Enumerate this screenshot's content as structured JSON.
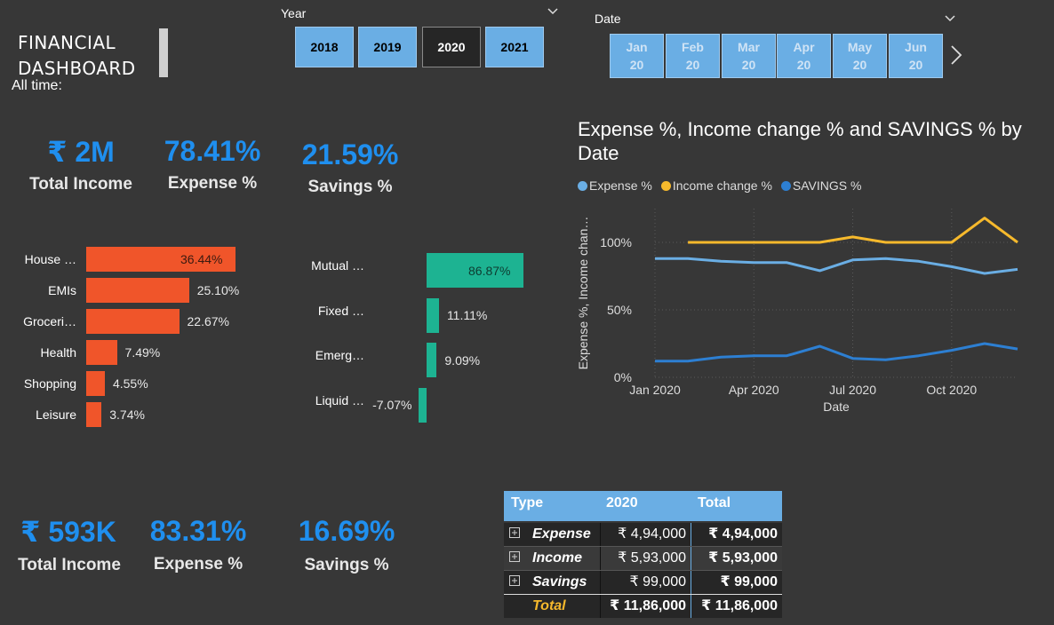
{
  "header": {
    "title_line1": "FINANCIAL",
    "title_line2": "DASHBOARD",
    "all_time": "All time:"
  },
  "year_slicer": {
    "label": "Year",
    "options": [
      "2018",
      "2019",
      "2020",
      "2021"
    ],
    "selected": "2020"
  },
  "date_slicer": {
    "label": "Date",
    "months": [
      {
        "m": "Jan",
        "y": "20"
      },
      {
        "m": "Feb",
        "y": "20"
      },
      {
        "m": "Mar",
        "y": "20"
      },
      {
        "m": "Apr",
        "y": "20"
      },
      {
        "m": "May",
        "y": "20"
      },
      {
        "m": "Jun",
        "y": "20"
      }
    ]
  },
  "kpis_top": {
    "income_value": "₹ 2M",
    "income_label": "Total Income",
    "expense_value": "78.41%",
    "expense_label": "Expense %",
    "savings_value": "21.59%",
    "savings_label": "Savings %"
  },
  "kpis_bottom": {
    "income_value": "₹ 593K",
    "income_label": "Total Income",
    "expense_value": "83.31%",
    "expense_label": "Expense %",
    "savings_value": "16.69%",
    "savings_label": "Savings %"
  },
  "expense_bars": {
    "color": "#f0552a",
    "items": [
      {
        "label": "House …",
        "value": 36.44,
        "text": "36.44%"
      },
      {
        "label": "EMIs",
        "value": 25.1,
        "text": "25.10%"
      },
      {
        "label": "Groceri…",
        "value": 22.67,
        "text": "22.67%"
      },
      {
        "label": "Health",
        "value": 7.49,
        "text": "7.49%"
      },
      {
        "label": "Shopping",
        "value": 4.55,
        "text": "4.55%"
      },
      {
        "label": "Leisure",
        "value": 3.74,
        "text": "3.74%"
      }
    ]
  },
  "savings_bars": {
    "color": "#1db392",
    "items": [
      {
        "label": "Mutual …",
        "value": 86.87,
        "text": "86.87%"
      },
      {
        "label": "Fixed …",
        "value": 11.11,
        "text": "11.11%"
      },
      {
        "label": "Emerg…",
        "value": 9.09,
        "text": "9.09%"
      },
      {
        "label": "Liquid …",
        "value": -7.07,
        "text": "-7.07%"
      }
    ]
  },
  "chart_data": {
    "type": "line",
    "title": "Expense %, Income change % and SAVINGS % by Date",
    "xlabel": "Date",
    "ylabel": "Expense %, Income chan…",
    "x": [
      "2020-01",
      "2020-02",
      "2020-03",
      "2020-04",
      "2020-05",
      "2020-06",
      "2020-07",
      "2020-08",
      "2020-09",
      "2020-10",
      "2020-11",
      "2020-12"
    ],
    "x_ticks": [
      "Jan 2020",
      "Apr 2020",
      "Jul 2020",
      "Oct 2020"
    ],
    "y_ticks": [
      "0%",
      "50%",
      "100%"
    ],
    "ylim": [
      0,
      125
    ],
    "grid": true,
    "legend_position": "top-left",
    "series": [
      {
        "name": "Expense %",
        "color": "#6aaee4",
        "values": [
          88,
          88,
          86,
          85,
          85,
          79,
          87,
          88,
          86,
          82,
          77,
          80
        ]
      },
      {
        "name": "Income change %",
        "color": "#f6b92c",
        "values": [
          null,
          100,
          100,
          100,
          100,
          100,
          104,
          100,
          100,
          100,
          118,
          100
        ]
      },
      {
        "name": "SAVINGS %",
        "color": "#2d7fd2",
        "values": [
          12,
          12,
          15,
          16,
          16,
          23,
          14,
          13,
          16,
          20,
          25,
          21
        ]
      }
    ]
  },
  "table": {
    "header_bg": "#6aaee4",
    "headers": [
      "Type",
      "2020",
      "Total"
    ],
    "rows": [
      {
        "type": "Expense",
        "y2020": "₹ 4,94,000",
        "total": "₹ 4,94,000"
      },
      {
        "type": "Income",
        "y2020": "₹ 5,93,000",
        "total": "₹ 5,93,000"
      },
      {
        "type": "Savings",
        "y2020": "₹ 99,000",
        "total": "₹ 99,000"
      }
    ],
    "total_row": {
      "type": "Total",
      "y2020": "₹ 11,86,000",
      "total": "₹ 11,86,000"
    },
    "expand_icon": "plus-box-icon"
  }
}
